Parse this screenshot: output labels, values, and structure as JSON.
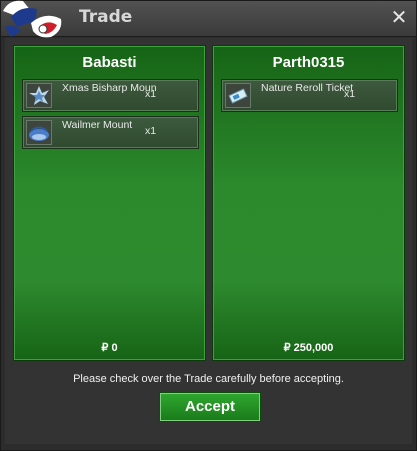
{
  "window": {
    "title": "Trade",
    "close_symbol": "✕"
  },
  "traders": [
    {
      "name": "Babasti",
      "money": "₽ 0",
      "items": [
        {
          "name": "Xmas Bisharp Moun",
          "qty": "x1",
          "icon": "bisharp-mount-icon"
        },
        {
          "name": "Wailmer Mount",
          "qty": "x1",
          "icon": "wailmer-mount-icon"
        }
      ]
    },
    {
      "name": "Parth0315",
      "money": "₽ 250,000",
      "items": [
        {
          "name": "Nature Reroll Ticket",
          "qty": "x1",
          "icon": "ticket-icon"
        }
      ]
    }
  ],
  "notice": "Please check over the Trade carefully before accepting.",
  "accept_label": "Accept",
  "colors": {
    "panel_green": "#2e8a2e",
    "accept_green": "#1f8f1f"
  }
}
